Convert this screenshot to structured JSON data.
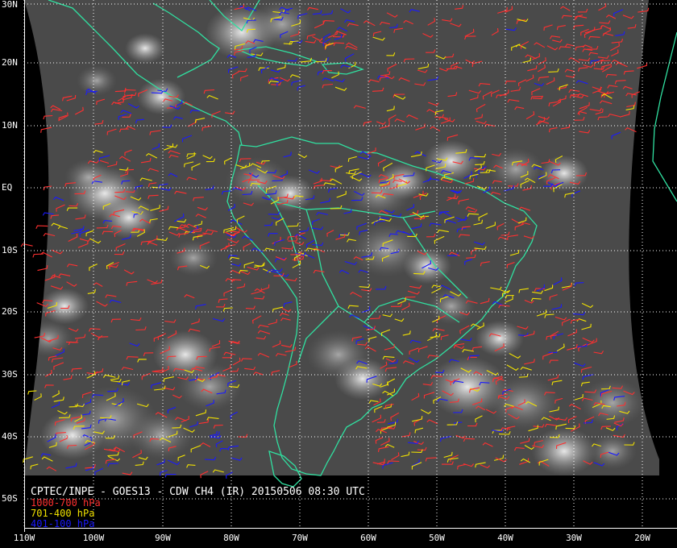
{
  "title": "CPTEC/INPE - GOES13 - CDW CH4 (IR) 20150506 08:30 UTC",
  "legend": [
    {
      "label": "1000-700 hPa",
      "color": "#ff3030"
    },
    {
      "label": "701-400 hPa",
      "color": "#f2e200"
    },
    {
      "label": "401-100 hPa",
      "color": "#1a1aff"
    }
  ],
  "colors": {
    "background": "#000000",
    "coastline": "#30e0a0",
    "grid": "#ffffff",
    "cloud_base": "#4a4a4a"
  },
  "lat_labels": [
    "30N",
    "20N",
    "10N",
    "EQ",
    "10S",
    "20S",
    "30S",
    "40S",
    "50S"
  ],
  "lon_labels": [
    "110W",
    "100W",
    "90W",
    "80W",
    "70W",
    "60W",
    "50W",
    "40W",
    "30W",
    "20W"
  ],
  "map_extent": {
    "lon_min": -111,
    "lon_max": -16,
    "lat_min": -55,
    "lat_max": 30
  },
  "gridline_style": "dotted white every 10 degrees"
}
